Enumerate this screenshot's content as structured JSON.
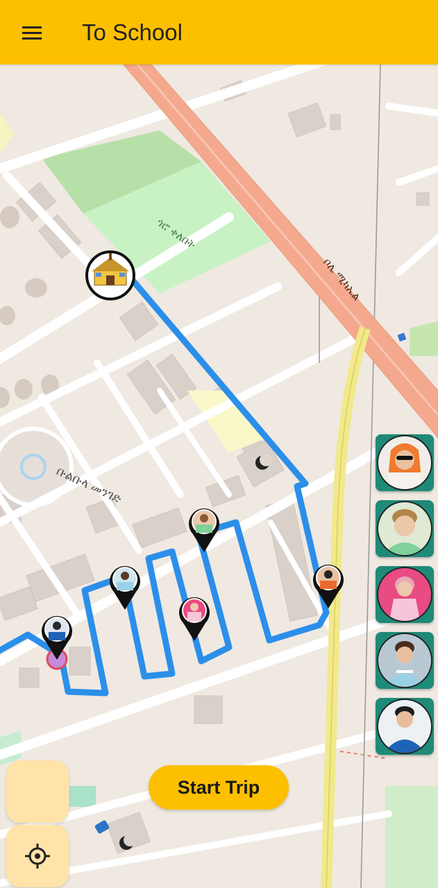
{
  "app_bar": {
    "title": "To School",
    "menu_icon": "menu-icon",
    "background": "#fdc000"
  },
  "map": {
    "route_color": "#2b8fea",
    "school_icon": "school-icon",
    "street_labels": [
      "ጎሮ ቀለበት",
      "ቦሌ ሚካኤል",
      "ቡልቡላ መንገድ"
    ]
  },
  "children": [
    {
      "name_icon": "child-1-avatar",
      "shirt": "#e86a2e",
      "skin": "#e9c2a2"
    },
    {
      "name_icon": "child-2-avatar",
      "shirt": "#7fd09a",
      "skin": "#ecc8aa"
    },
    {
      "name_icon": "child-3-avatar",
      "shirt": "#f7c5da",
      "skin": "#efc7ad"
    },
    {
      "name_icon": "child-4-avatar",
      "shirt": "#9ad0e6",
      "skin": "#e8c0a0"
    },
    {
      "name_icon": "child-5-avatar",
      "shirt": "#1f63b8",
      "skin": "#e7bd9d"
    }
  ],
  "controls": {
    "start_trip_label": "Start Trip",
    "layers_button_icon": "blank",
    "locate_button_icon": "crosshair-icon",
    "button_color": "#fdc000",
    "fab_color": "#ffe3a8"
  }
}
